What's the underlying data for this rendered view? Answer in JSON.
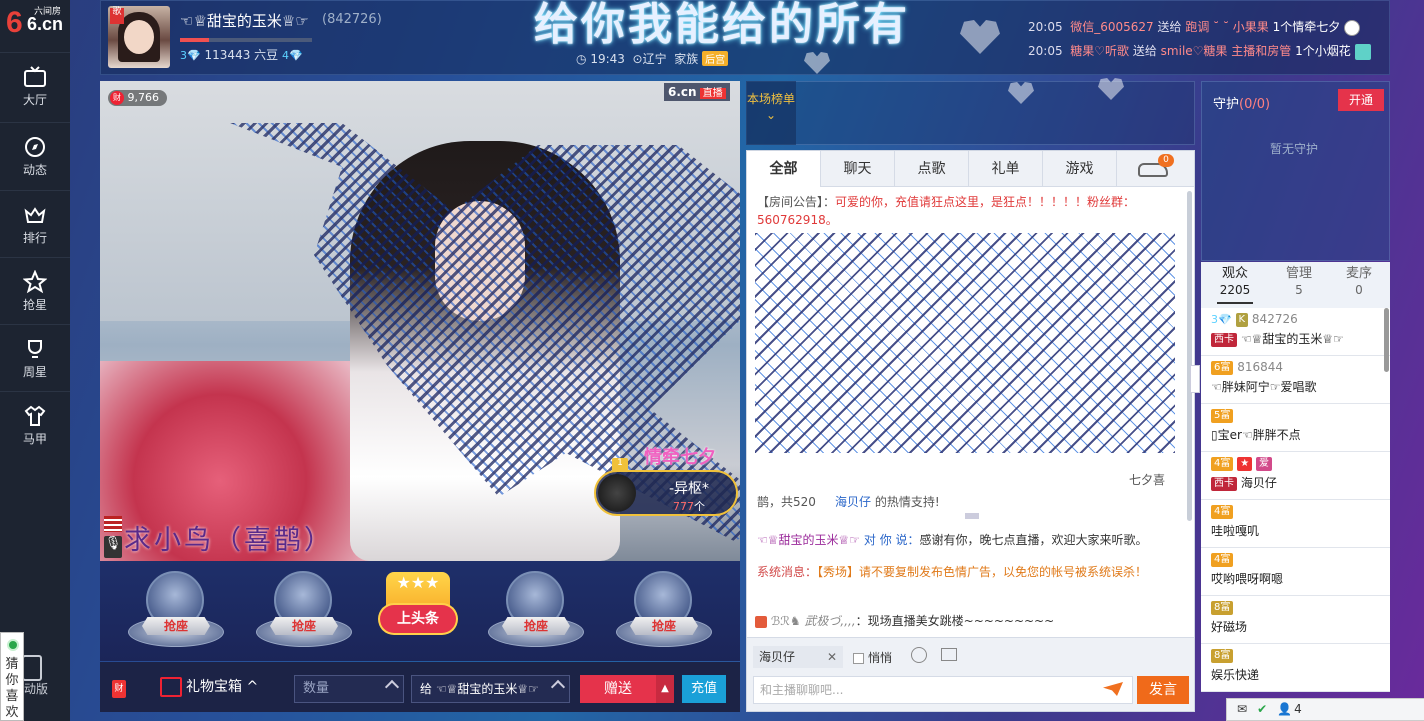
{
  "nav": {
    "logo_main": "6.cn",
    "logo_sub": "六间房",
    "items": [
      {
        "label": "大厅",
        "icon": "tv-icon"
      },
      {
        "label": "动态",
        "icon": "compass-icon"
      },
      {
        "label": "排行",
        "icon": "crown-icon"
      },
      {
        "label": "抢星",
        "icon": "star-icon"
      },
      {
        "label": "周星",
        "icon": "trophy-icon"
      },
      {
        "label": "马甲",
        "icon": "shirt-icon"
      }
    ],
    "mobile_label": "动版",
    "guess_label": "猜你喜欢"
  },
  "header": {
    "anchor_name": "☜♕甜宝的玉米♕☞",
    "anchor_id": "(842726)",
    "anchor_tag": "歌",
    "beans_prefix": "3",
    "beans": "113443 六豆",
    "beans_suffix": "4",
    "level_progress": 0.22,
    "big_title": "给你我能给的所有",
    "time": "19:43",
    "location": "辽宁",
    "family_label": "家族",
    "family_badge": "后宫",
    "gift_feed": [
      {
        "time": "20:05",
        "user": "微信_6005627",
        "verb": "送给",
        "target": "跑调 ˘ ˘ 小果果",
        "gift": "1个情牵七夕"
      },
      {
        "time": "20:05",
        "user": "糖果♡听歌",
        "verb": "送给",
        "target": "smile♡糖果 主播和房管",
        "gift": "1个小烟花"
      }
    ]
  },
  "video": {
    "viewers": "9,766",
    "live_logo": "6.cn",
    "live_label": "直播",
    "song": "求小鸟（喜鹊）",
    "fan_label": "情牵七夕",
    "fan_rank": "1",
    "fan_name": "-异枢*",
    "fan_count": "777",
    "fan_unit": "个"
  },
  "seats": {
    "grab_label": "抢座",
    "headline_label": "上头条"
  },
  "giftbar": {
    "cai": "财",
    "gift_box": "礼物宝箱",
    "qty_placeholder": "数量",
    "target_prefix": "给",
    "target_name": "☜♕甜宝的玉米♕☞",
    "send": "赠送",
    "recharge": "充值"
  },
  "rank": {
    "label": "本场榜单"
  },
  "chat": {
    "tabs": [
      "全部",
      "聊天",
      "点歌",
      "礼单",
      "游戏"
    ],
    "car_count": "0",
    "notice_prefix": "【房间公告】：",
    "notice_body": "可爱的你，充值请狂点这里，是狂点！！！！！粉丝群：560762918。",
    "msg1_a": "七夕喜",
    "msg1_b": "鹊，共520",
    "msg1_user": "海贝仔",
    "msg1_end": "的热情支持!",
    "msg2_user": "☜♕甜宝的玉米♕☞",
    "msg2_to": "对 你 说：",
    "msg2_body": "感谢有你，晚七点直播，欢迎大家来听歌。",
    "msg3_sys": "系统消息：",
    "msg3_body": "【秀场】请不要复制发布色情广告，以免您的帐号被系统误杀！",
    "msg4_user": "ℬℛ♞ 武极づ,,,,",
    "msg4_body": "：现场直播美女跳楼~~~~~~~~~",
    "recipient": "海贝仔",
    "whisper": "悄悄",
    "input_placeholder": "和主播聊聊吧...",
    "send_label": "发言"
  },
  "guard": {
    "title": "守护",
    "count": "(0/0)",
    "open_label": "开通",
    "empty": "暂无守护"
  },
  "audience": {
    "tabs": [
      {
        "label": "观众",
        "count": "2205"
      },
      {
        "label": "管理",
        "count": "5"
      },
      {
        "label": "麦序",
        "count": "0"
      }
    ],
    "list": [
      {
        "l1": "842726",
        "badges": [
          "3",
          "K"
        ],
        "tag": "西卡",
        "l2": "☜♕甜宝的玉米♕☞"
      },
      {
        "l1": "816844",
        "badges": [
          "6富"
        ],
        "tag": "",
        "l2": "☜胖妹阿宁☞爱唱歌"
      },
      {
        "l1": "",
        "badges": [
          "5富"
        ],
        "tag": "",
        "l2": "宝er☜胖胖不点"
      },
      {
        "l1": "",
        "badges": [
          "4富",
          "★",
          "爱"
        ],
        "tag": "西卡",
        "l2": "海贝仔"
      },
      {
        "l1": "",
        "badges": [
          "4富"
        ],
        "tag": "",
        "l2": "哇啦嘎叽"
      },
      {
        "l1": "",
        "badges": [
          "4富"
        ],
        "tag": "",
        "l2": "哎哟喂呀啊嗯"
      },
      {
        "l1": "",
        "badges": [
          "8富"
        ],
        "tag": "",
        "l2": "好磁场"
      },
      {
        "l1": "",
        "badges": [
          "8富"
        ],
        "tag": "",
        "l2": "娱乐快递"
      }
    ]
  },
  "status": {
    "count": "4"
  }
}
